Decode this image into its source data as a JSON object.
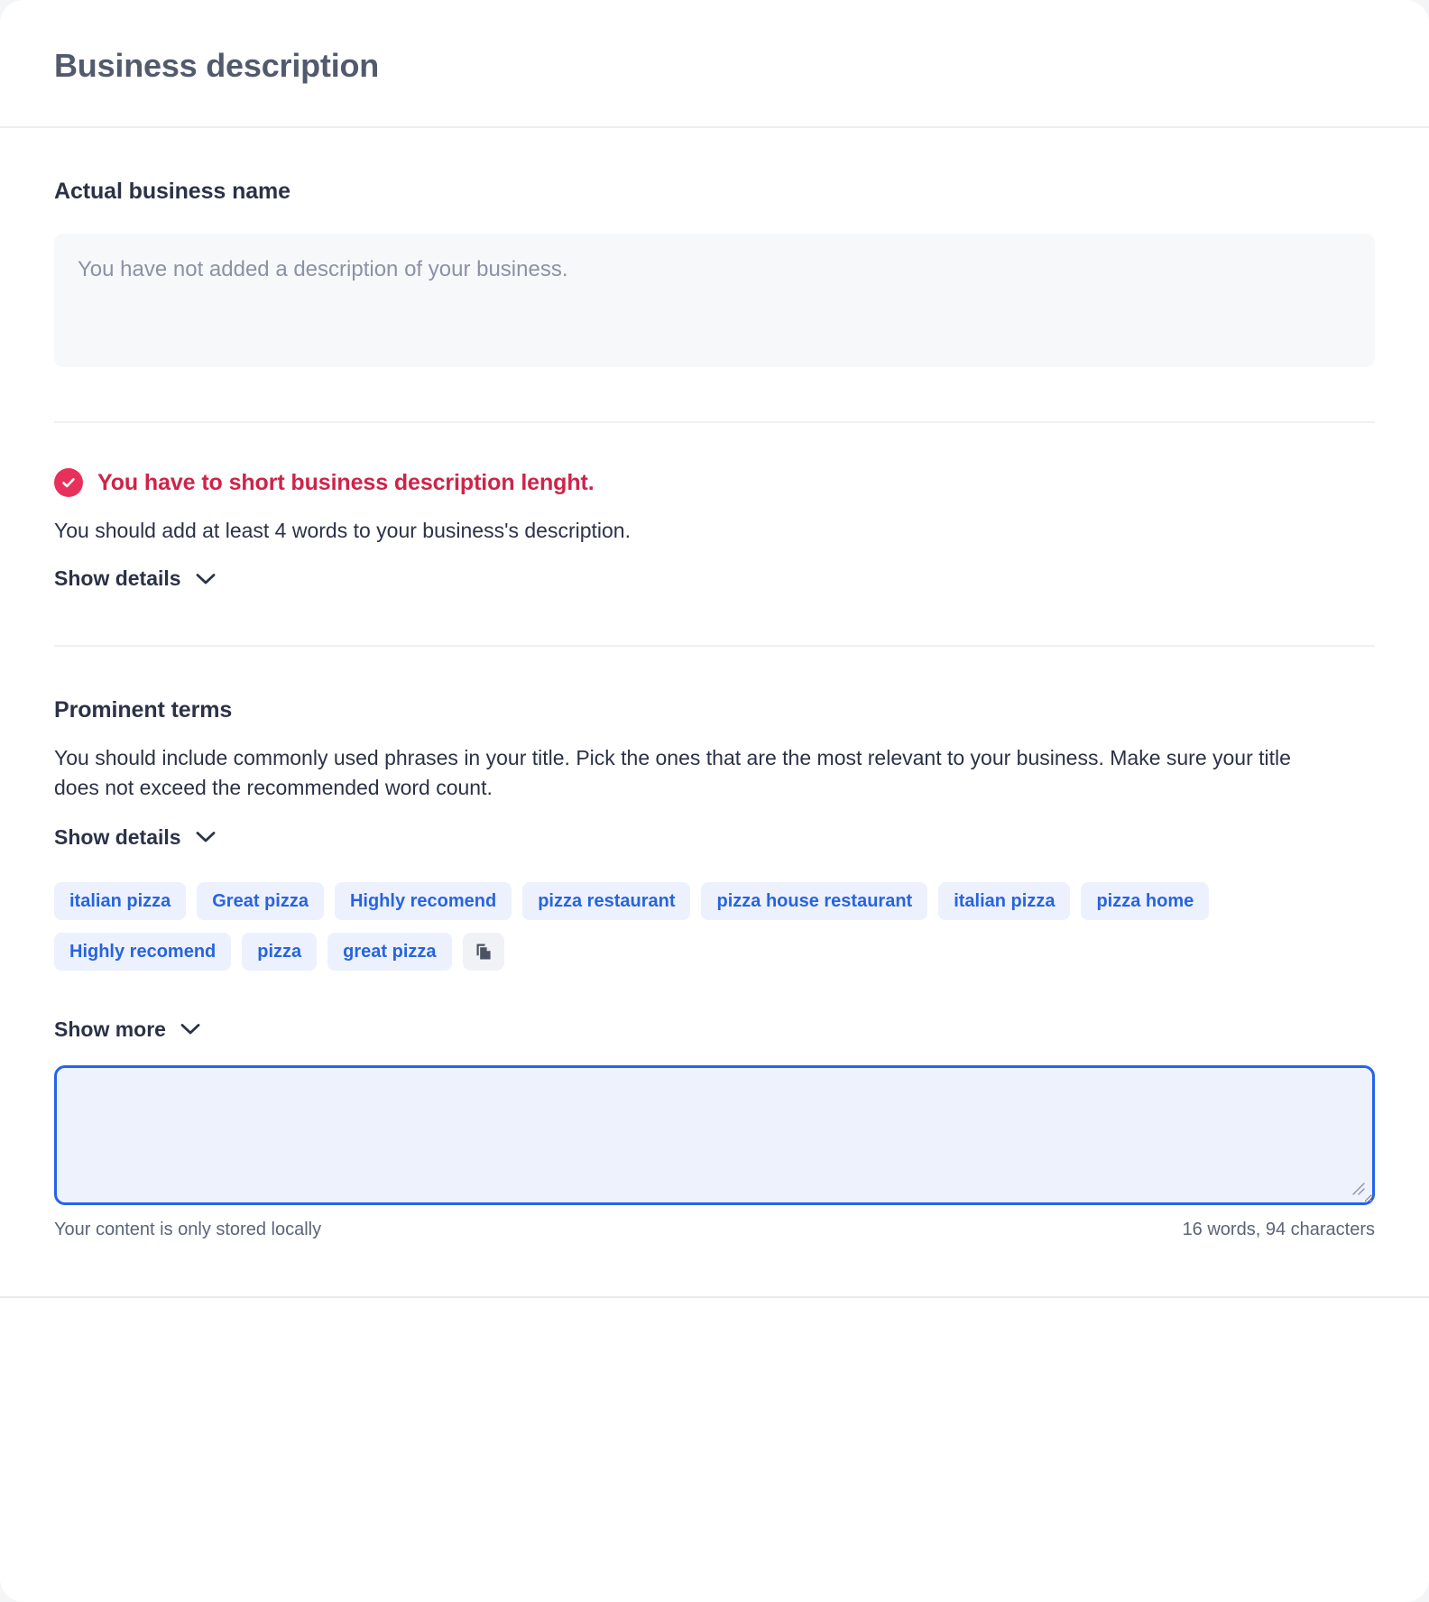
{
  "header": {
    "title": "Business description"
  },
  "business_name_section": {
    "title": "Actual business name",
    "placeholder_text": "You have not added a description of your business."
  },
  "alert": {
    "icon": "check-circle-icon",
    "icon_color": "#e8315a",
    "title": "You have to short business description lenght.",
    "description": "You should add at least 4 words to your business's description.",
    "toggle_label": "Show details",
    "toggle_icon": "chevron-down-icon"
  },
  "prominent_terms": {
    "title": "Prominent terms",
    "description": "You should include commonly used phrases in your title. Pick the ones that are the most relevant to your business. Make sure your title does not exceed the recommended word count.",
    "toggle_label": "Show details",
    "toggle_icon": "chevron-down-icon",
    "chips": [
      "italian pizza",
      "Great pizza",
      "Highly recomend",
      "pizza restaurant",
      "pizza house restaurant",
      "italian pizza",
      "pizza home",
      "Highly recomend",
      "pizza",
      "great pizza"
    ],
    "copy_icon": "copy-icon",
    "show_more_label": "Show more",
    "show_more_icon": "chevron-down-icon"
  },
  "editor": {
    "value": "",
    "placeholder": "",
    "storage_note": "Your content is only stored locally",
    "counter": "16 words, 94 characters"
  },
  "colors": {
    "accent_blue": "#2764df",
    "chip_bg": "#edf1fd",
    "error_red": "#cf2348",
    "error_icon": "#e8315a",
    "text_dark": "#2b3248",
    "heading_gray": "#525a6e"
  }
}
